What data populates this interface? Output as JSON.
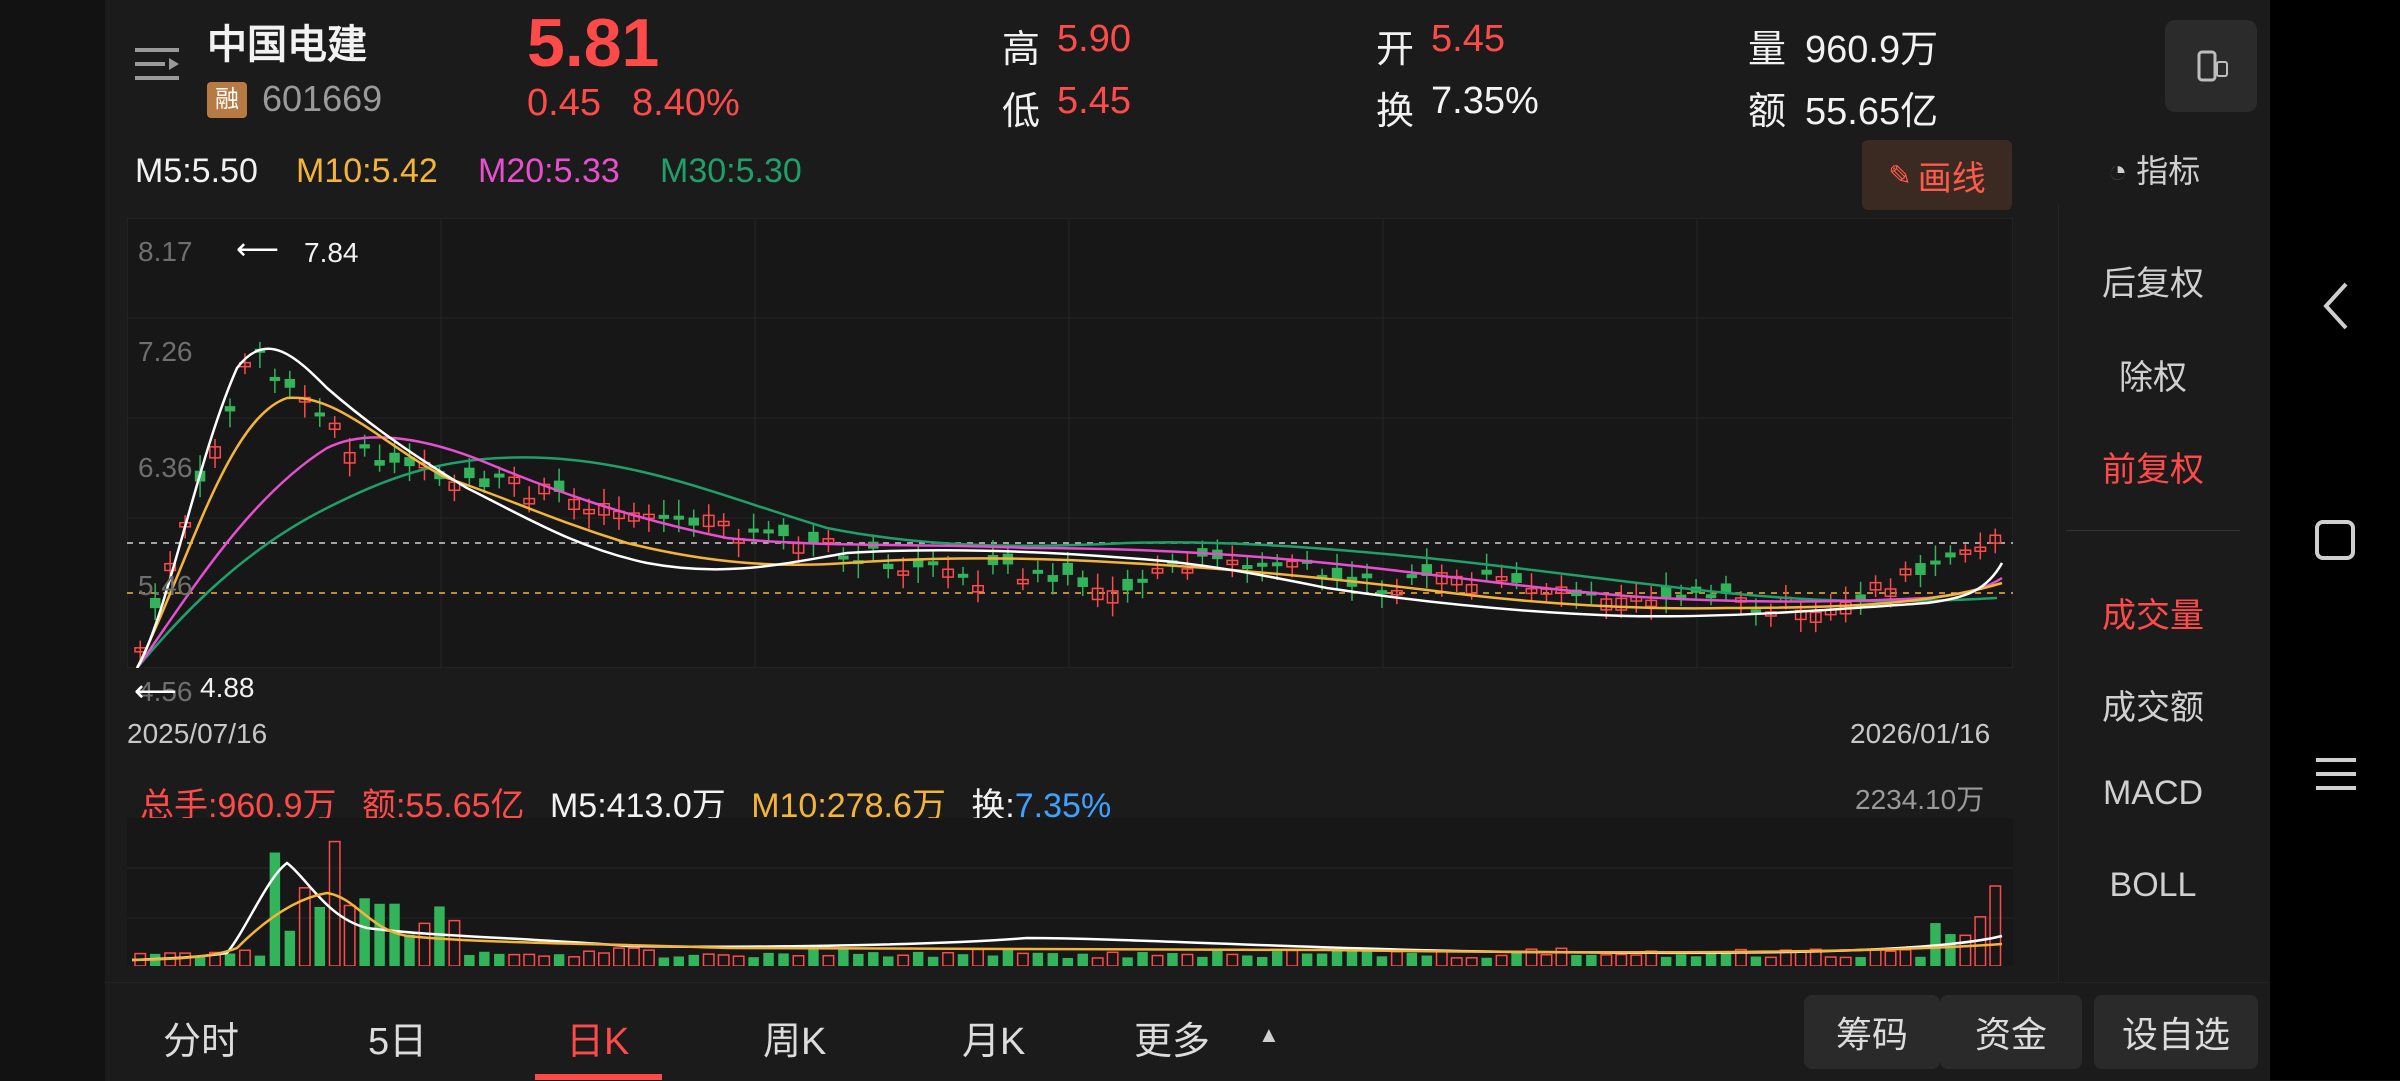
{
  "stock": {
    "name": "中国电建",
    "rong": "融",
    "code": "601669",
    "price": "5.81",
    "change": "0.45",
    "change_pct": "8.40%"
  },
  "stats": {
    "high_label": "高",
    "high": "5.90",
    "low_label": "低",
    "low": "5.45",
    "open_label": "开",
    "open": "5.45",
    "turnover_label": "换",
    "turnover": "7.35%",
    "volume_label": "量",
    "volume": "960.9万",
    "amount_label": "额",
    "amount": "55.65亿"
  },
  "ma": {
    "m5": "M5:5.50",
    "m10": "M10:5.42",
    "m20": "M20:5.33",
    "m30": "M30:5.30"
  },
  "draw_button": "画线",
  "indicator_button": "指标",
  "axis": {
    "y_top": "8.17",
    "y_2": "7.26",
    "y_3": "6.36",
    "y_4": "5.46",
    "y_5": "4.56",
    "high_mark": "7.84",
    "low_mark": "4.88",
    "date_start": "2025/07/16",
    "date_end": "2026/01/16"
  },
  "volume_panel": {
    "total": "总手:960.9万",
    "amount": "额:55.65亿",
    "m5": "M5:413.0万",
    "m10": "M10:278.6万",
    "turnover_label": "换:",
    "turnover_value": "7.35%",
    "max": "2234.10万"
  },
  "side_panel": {
    "items": [
      "后复权",
      "除权",
      "前复权",
      "成交量",
      "成交额",
      "MACD",
      "BOLL"
    ]
  },
  "tabs": [
    "分时",
    "5日",
    "日K",
    "周K",
    "月K",
    "更多"
  ],
  "bottom_buttons": [
    "筹码",
    "资金",
    "设自选"
  ],
  "colors": {
    "up": "#ff4a4a",
    "down": "#33b35a",
    "ma5": "#ffffff",
    "ma10": "#f4b43a",
    "ma20": "#e84fcf",
    "ma30": "#1fa06b"
  }
}
